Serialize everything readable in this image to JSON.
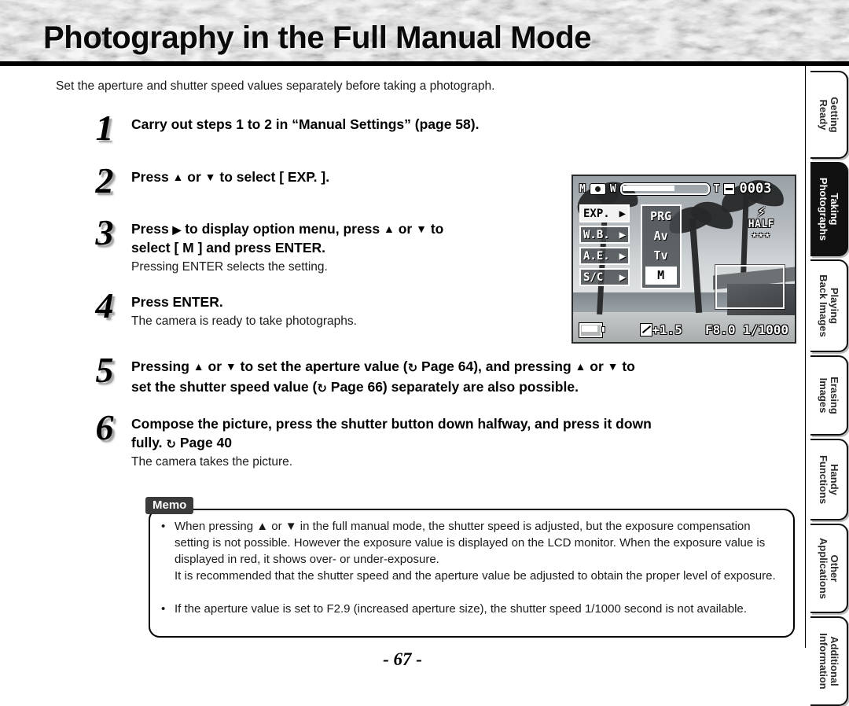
{
  "header": {
    "title": "Photography in the Full Manual Mode"
  },
  "intro": "Set the aperture and shutter speed values separately before taking a photograph.",
  "steps": [
    {
      "num": "1",
      "text": "Carry out steps 1 to 2 in “Manual Settings” (page 58).",
      "sub": ""
    },
    {
      "num": "2",
      "text_a": "Press ",
      "text_b": " or ",
      "text_c": " to select [ EXP. ].",
      "sub": ""
    },
    {
      "num": "3",
      "line1_a": "Press ",
      "line1_b": " to display option menu, press ",
      "line1_c": " or ",
      "line1_d": " to",
      "line2": "select  [ M ] and press ENTER.",
      "sub": "Pressing ENTER selects the setting."
    },
    {
      "num": "4",
      "text": "Press ENTER.",
      "sub": "The camera is ready to take photographs."
    },
    {
      "num": "5",
      "line1_a": "Pressing ",
      "line1_b": " or ",
      "line1_c": " to set the aperture value (",
      "line1_d": " Page 64),  and pressing ",
      "line1_e": " or ",
      "line1_f": " to",
      "line2_a": "set the shutter speed value (",
      "line2_b": " Page 66) separately are also possible.",
      "sub": ""
    },
    {
      "num": "6",
      "line1": "Compose the picture, press the shutter button down halfway, and press it down",
      "line2_a": "fully. ",
      "line2_b": " Page 40",
      "sub": "The camera takes the picture."
    }
  ],
  "lcd": {
    "mode_letter": "M",
    "camera_icon": "camera-icon",
    "zoom_wide": "W",
    "zoom_tele": "T",
    "card_icon": "card-icon",
    "frames_remaining": "0003",
    "menu_items": [
      {
        "label": "EXP.",
        "arrow": "▶",
        "selected": true
      },
      {
        "label": "W.B.",
        "arrow": "▶",
        "selected": false
      },
      {
        "label": "A.E.",
        "arrow": "▶",
        "selected": false
      },
      {
        "label": "S/C",
        "arrow": "▶",
        "selected": false
      }
    ],
    "options": [
      {
        "label": "PRG",
        "selected": false
      },
      {
        "label": "Av",
        "selected": false
      },
      {
        "label": "Tv",
        "selected": false
      },
      {
        "label": "M",
        "selected": true
      }
    ],
    "flash_icon": "⚡",
    "half_label": "HALF",
    "stars": "★★★",
    "battery_icon": "battery-icon",
    "ev_icon": "exposure-compensation-icon",
    "ev_value": "+1.5",
    "aperture": "F8.0",
    "shutter_speed": "1/1000"
  },
  "memo": {
    "tab_label": "Memo",
    "items": [
      "When pressing ▲ or ▼ in the full manual mode, the shutter speed is adjusted, but the exposure compensation setting is not possible. However the exposure value is displayed on the LCD monitor. When the exposure value is displayed in red, it shows over- or under-exposure.",
      "It is recommended that the shutter speed and the aperture value be adjusted to obtain the proper level of exposure.",
      "If the aperture value is set to F2.9 (increased aperture size), the shutter speed 1/1000 second is not available."
    ]
  },
  "page_number": "- 67 -",
  "tabs": [
    {
      "line1": "Getting",
      "line2": "Ready",
      "active": false
    },
    {
      "line1": "Taking",
      "line2": "Photographs",
      "active": true
    },
    {
      "line1": "Playing",
      "line2": "Back Images",
      "active": false
    },
    {
      "line1": "Erasing",
      "line2": "Images",
      "active": false
    },
    {
      "line1": "Handy",
      "line2": "Functions",
      "active": false
    },
    {
      "line1": "Other",
      "line2": "Applications",
      "active": false
    },
    {
      "line1": "Additional",
      "line2": "Information",
      "active": false
    }
  ],
  "colors": {
    "accent": "#000000",
    "tab_active_bg": "#111111",
    "memo_tab_bg": "#3b3b3b"
  }
}
